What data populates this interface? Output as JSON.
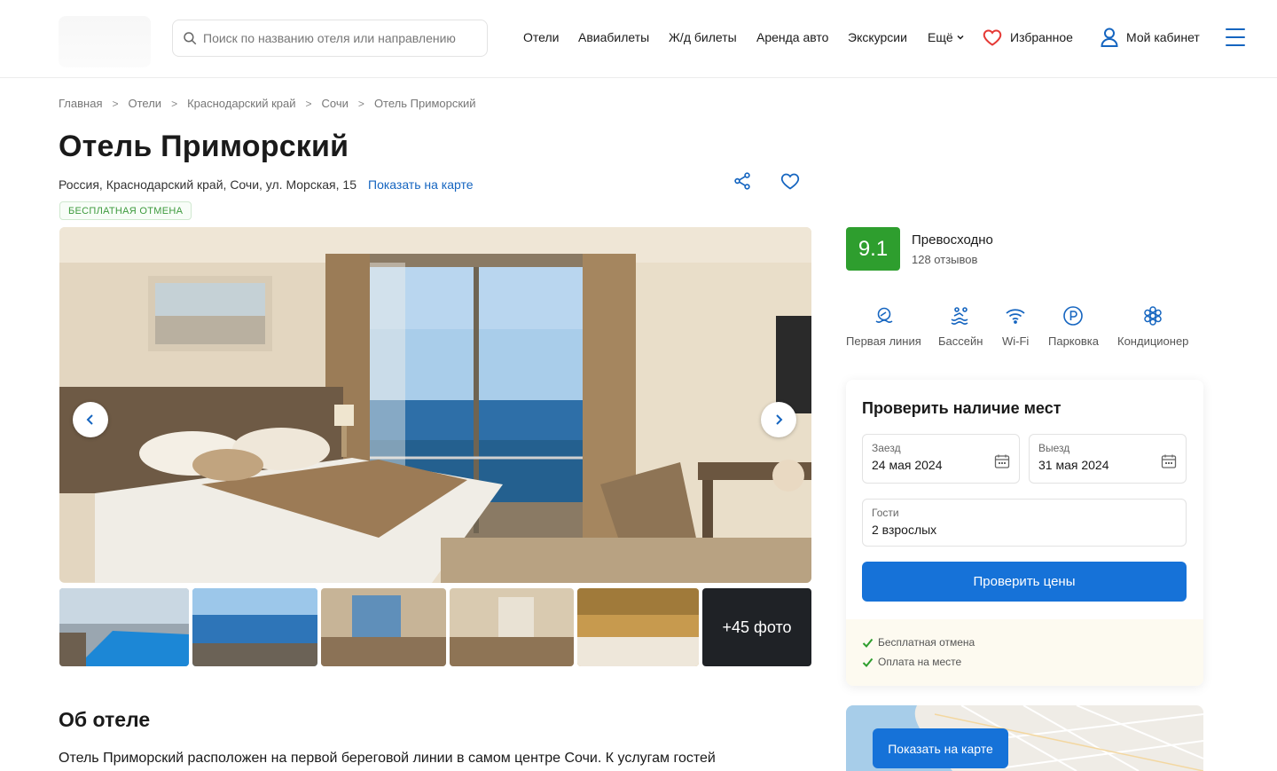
{
  "header": {
    "search_placeholder": "Поиск по названию отеля или направлению",
    "nav": [
      "Отели",
      "Авиабилеты",
      "Ж/д билеты",
      "Аренда авто",
      "Экскурсии"
    ],
    "more_label": "Ещё",
    "favorites_label": "Избранное",
    "cabinet_label": "Мой кабинет"
  },
  "breadcrumb": [
    "Главная",
    "Отели",
    "Краснодарский край",
    "Сочи",
    "Отель Приморский"
  ],
  "hotel": {
    "name": "Отель Приморский",
    "address": "Россия, Краснодарский край, Сочи, ул. Морская, 15",
    "map_link": "Показать на карте",
    "badge": "БЕСПЛАТНАЯ ОТМЕНА"
  },
  "gallery": {
    "more_photos": "+45 фото"
  },
  "rating": {
    "score": "9.1",
    "word": "Превосходно",
    "reviews": "128 отзывов"
  },
  "amenities": [
    {
      "label": "Первая линия",
      "icon": "beach-icon"
    },
    {
      "label": "Бассейн",
      "icon": "pool-icon"
    },
    {
      "label": "Wi-Fi",
      "icon": "wifi-icon"
    },
    {
      "label": "Парковка",
      "icon": "parking-icon"
    },
    {
      "label": "Кондиционер",
      "icon": "snowflake-icon"
    }
  ],
  "booking": {
    "title": "Проверить наличие мест",
    "checkin_label": "Заезд",
    "checkin_value": "24 мая 2024",
    "checkout_label": "Выезд",
    "checkout_value": "31 мая 2024",
    "guests_label": "Гости",
    "guests_value": "2 взрослых",
    "button": "Проверить цены",
    "perks": [
      "Бесплатная отмена",
      "Оплата на месте"
    ]
  },
  "map": {
    "button": "Показать на карте"
  },
  "about": {
    "title": "Об отеле",
    "text": "Отель Приморский расположен на первой береговой линии в самом центре Сочи. К услугам гостей"
  },
  "colors": {
    "accent": "#1672d8",
    "rating": "#2e9e2e",
    "link": "#1565c0",
    "heart": "#e53935"
  }
}
